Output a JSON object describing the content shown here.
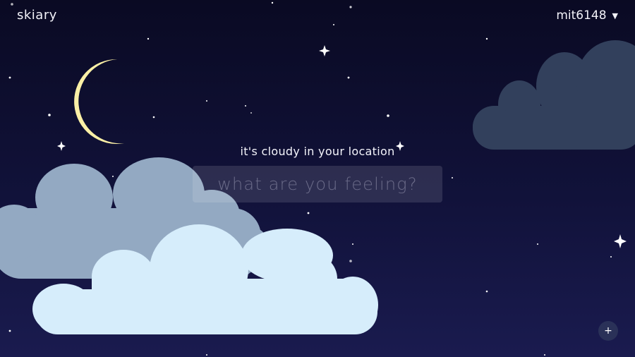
{
  "header": {
    "logo": "skiary",
    "username": "mit6148",
    "user_menu_icon": "caret-down-icon"
  },
  "main": {
    "weather_message": "it's cloudy in your location",
    "feeling_input": {
      "placeholder": "what are you feeling?",
      "value": ""
    }
  },
  "fab": {
    "label": "+",
    "icon": "plus-icon"
  },
  "colors": {
    "sky_top": "#0a0a23",
    "sky_bottom": "#1a1b4f",
    "moon": "#fbf0a6",
    "cloud_far": "#32405c",
    "cloud_mid": "#93a9c2",
    "cloud_front": "#d6edfb",
    "input_bg": "rgba(255,255,255,0.12)"
  }
}
